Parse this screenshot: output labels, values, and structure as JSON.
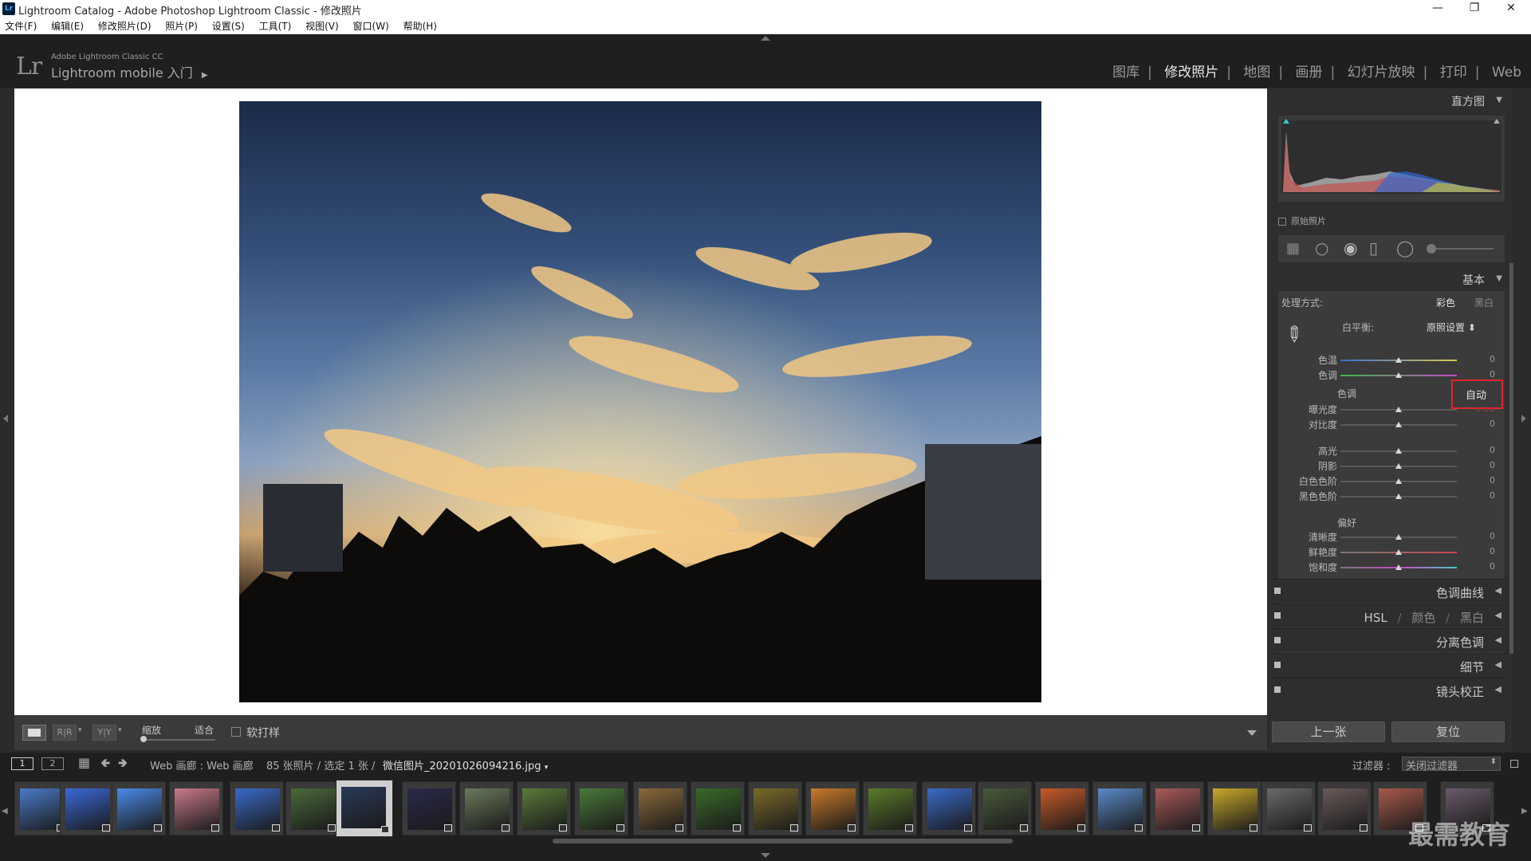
{
  "window": {
    "title": "Lightroom Catalog - Adobe Photoshop Lightroom Classic - 修改照片",
    "app_icon": "Lr"
  },
  "menu": [
    "文件(F)",
    "编辑(E)",
    "修改照片(D)",
    "照片(P)",
    "设置(S)",
    "工具(T)",
    "视图(V)",
    "窗口(W)",
    "帮助(H)"
  ],
  "identity": {
    "logo": "Lr",
    "small": "Adobe Lightroom Classic CC",
    "big": "Lightroom mobile 入门"
  },
  "modules": [
    {
      "label": "图库",
      "active": false
    },
    {
      "label": "修改照片",
      "active": true
    },
    {
      "label": "地图",
      "active": false
    },
    {
      "label": "画册",
      "active": false
    },
    {
      "label": "幻灯片放映",
      "active": false
    },
    {
      "label": "打印",
      "active": false
    },
    {
      "label": "Web",
      "active": false
    }
  ],
  "toolbar": {
    "zoom_label": "缩放",
    "fit_label": "适合",
    "softproof_label": "软打样"
  },
  "histogram": {
    "title": "直方图",
    "original_photo": "原始照片"
  },
  "basic": {
    "title": "基本",
    "treatment_label": "处理方式:",
    "color": "彩色",
    "bw": "黑白",
    "wb_label": "白平衡:",
    "wb_value": "原照设置",
    "temp": {
      "label": "色温",
      "value": "0"
    },
    "tint": {
      "label": "色调",
      "value": "0"
    },
    "tone_label": "色调",
    "auto": "自动",
    "exposure": {
      "label": "曝光度",
      "value": "0.00"
    },
    "contrast": {
      "label": "对比度",
      "value": "0"
    },
    "highlights": {
      "label": "高光",
      "value": "0"
    },
    "shadows": {
      "label": "阴影",
      "value": "0"
    },
    "whites": {
      "label": "白色色阶",
      "value": "0"
    },
    "blacks": {
      "label": "黑色色阶",
      "value": "0"
    },
    "presence_label": "偏好",
    "clarity": {
      "label": "清晰度",
      "value": "0"
    },
    "vibrance": {
      "label": "鲜艳度",
      "value": "0"
    },
    "saturation": {
      "label": "饱和度",
      "value": "0"
    }
  },
  "panels": {
    "tone_curve": "色调曲线",
    "hsl": "HSL",
    "hsl_color": "颜色",
    "hsl_bw": "黑白",
    "hsl_sep": "/",
    "split_toning": "分离色调",
    "detail": "细节",
    "lens": "镜头校正"
  },
  "buttons": {
    "previous": "上一张",
    "reset": "复位"
  },
  "filmstrip_bar": {
    "page1": "1",
    "page2": "2",
    "source": "Web 画廊 : Web 画廊",
    "count": "85 张照片 / 选定 1 张 /",
    "filename": "微信图片_20201026094216.jpg",
    "filter_label": "过滤器 :",
    "filter_value": "关闭过滤器"
  },
  "watermark": "最需教育",
  "colors": {
    "accent_red": "#e0252b",
    "panel_bg": "#2e2e2e",
    "header_bg": "#1f1f1f"
  }
}
